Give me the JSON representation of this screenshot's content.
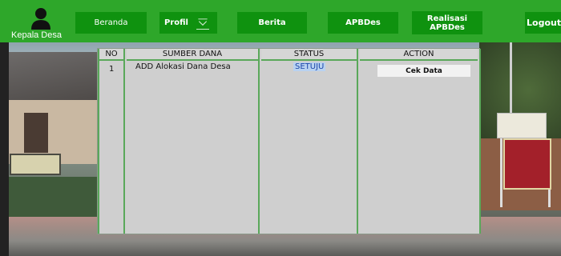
{
  "nav": {
    "user_label": "Kepala Desa",
    "items": [
      {
        "label": "Beranda"
      },
      {
        "label": "Profil"
      },
      {
        "label": "Berita"
      },
      {
        "label": "APBDes"
      },
      {
        "label": "Realisasi APBDes"
      }
    ],
    "logout_label": "Logout"
  },
  "table": {
    "headers": [
      "NO",
      "SUMBER DANA",
      "STATUS",
      "ACTION"
    ],
    "rows": [
      {
        "no": "1",
        "sumber_dana": "ADD Alokasi Dana Desa",
        "status": "SETUJU",
        "action_label": "Cek Data"
      }
    ]
  },
  "colors": {
    "nav_bar": "#2ea72a",
    "nav_button": "#0f920f",
    "table_lines": "#5aa85a",
    "table_bg": "#cfcfcf"
  },
  "icons": [
    "user-icon",
    "chevron-down-icon"
  ]
}
